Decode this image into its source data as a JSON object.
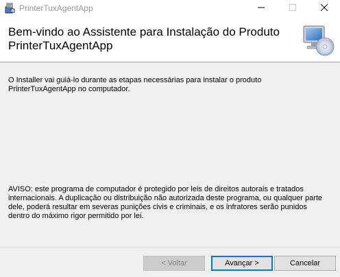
{
  "window": {
    "title": "PrinterTuxAgentApp",
    "icons": {
      "app": "installer-package-icon",
      "minimize": "minimize-icon",
      "maximize": "maximize-icon",
      "close": "close-icon"
    }
  },
  "banner": {
    "title": "Bem-vindo ao Assistente para Instalação do Produto PrinterTuxAgentApp",
    "icon": "computer-cd-icon"
  },
  "body": {
    "intro": "O Installer vai guiá-lo durante as etapas necessárias para instalar o produto PrinterTuxAgentApp no computador.",
    "warning": "AVISO: este programa de computador é protegido por leis de direitos autorais e tratados internacionais. A duplicação ou distribuição não autorizada deste programa, ou qualquer parte dele, poderá resultar em severas punições civis e criminais, e os infratores serão punidos dentro do máximo rigor permitido por lei."
  },
  "buttons": {
    "back": "< Voltar",
    "next": "Avançar >",
    "cancel": "Cancelar"
  },
  "colors": {
    "accent": "#0078d7",
    "background": "#f0f0f0",
    "banner_bg": "#ffffff"
  }
}
